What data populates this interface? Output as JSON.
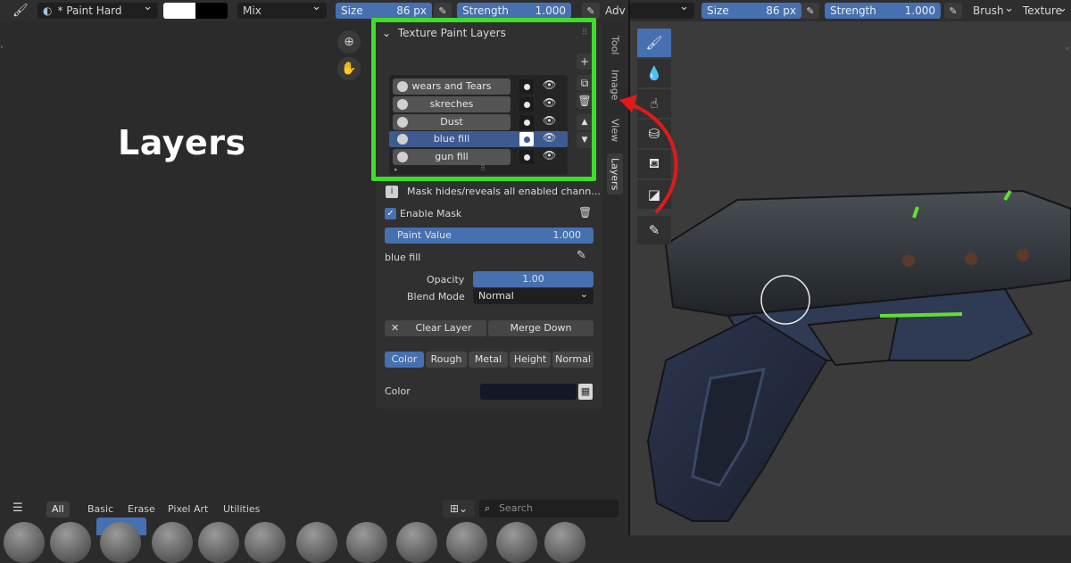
{
  "toolbar_left": {
    "brush_name": "* Paint Hard",
    "blend_mode": "Mix",
    "size_label": "Size",
    "size_value": "86 px",
    "strength_label": "Strength",
    "strength_value": "1.000",
    "advanced_label": "Adv"
  },
  "toolbar_right": {
    "size_label": "Size",
    "size_value": "86 px",
    "strength_label": "Strength",
    "strength_value": "1.000",
    "brush_menu": "Brush",
    "texture_menu": "Texture"
  },
  "overlay_title": "Layers",
  "panel": {
    "header": "Texture Paint Layers",
    "layers": [
      {
        "name": "wears and Tears"
      },
      {
        "name": "skreches"
      },
      {
        "name": "Dust"
      },
      {
        "name": "blue fill"
      },
      {
        "name": "gun fill"
      }
    ],
    "mask_info": "Mask hides/reveals all enabled chann...",
    "enable_mask": "Enable Mask",
    "paint_value_label": "Paint Value",
    "paint_value": "1.000",
    "active_layer": "blue fill",
    "opacity_label": "Opacity",
    "opacity_value": "1.00",
    "blend_mode_label": "Blend Mode",
    "blend_mode_value": "Normal",
    "clear_layer": "Clear Layer",
    "merge_down": "Merge Down",
    "channel_tabs": [
      "Color",
      "Rough",
      "Metal",
      "Height",
      "Normal"
    ],
    "color_label": "Color"
  },
  "side_tabs": [
    "Tool",
    "Image",
    "View",
    "Layers"
  ],
  "bottom": {
    "categories": [
      "All",
      "Basic",
      "Erase",
      "Pixel Art",
      "Utilities"
    ],
    "search_placeholder": "Search"
  },
  "colors": {
    "accent_blue": "#4670b0",
    "highlight_green": "#3fdc2a",
    "arrow_red": "#e01a1a",
    "selected_row": "#3d5b91"
  }
}
